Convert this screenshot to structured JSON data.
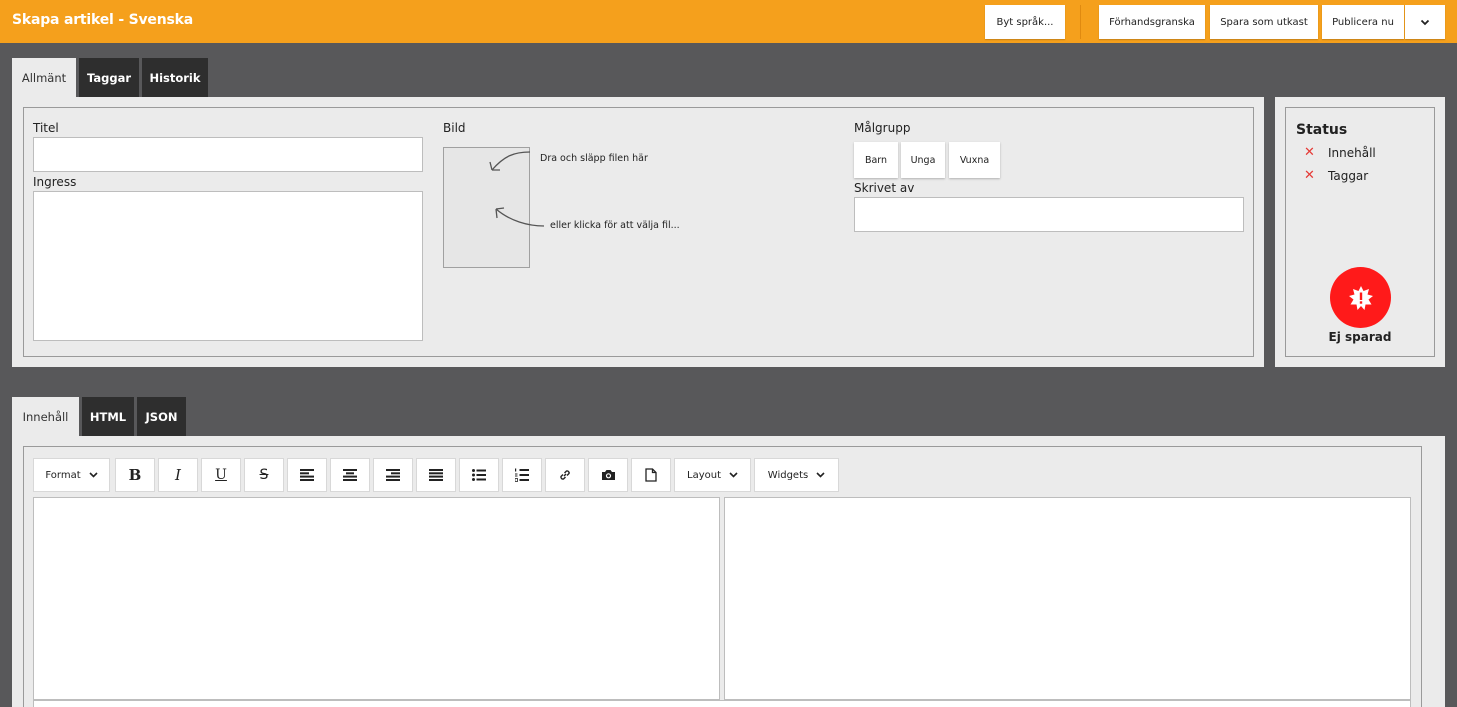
{
  "header": {
    "title": "Skapa artikel - Svenska",
    "buttons": {
      "switch_language": "Byt språk...",
      "preview": "Förhandsgranska",
      "save_draft": "Spara som utkast",
      "publish_now": "Publicera nu"
    }
  },
  "top_tabs": [
    "Allmänt",
    "Taggar",
    "Historik"
  ],
  "form": {
    "title_label": "Titel",
    "title_value": "",
    "ingress_label": "Ingress",
    "ingress_value": "",
    "image_label": "Bild",
    "image_hint_drag": "Dra och släpp filen här",
    "image_hint_click": "eller klicka för att välja fil...",
    "audience_label": "Målgrupp",
    "audience_options": [
      "Barn",
      "Unga",
      "Vuxna"
    ],
    "author_label": "Skrivet av",
    "author_value": ""
  },
  "status": {
    "title": "Status",
    "items": [
      "Innehåll",
      "Taggar"
    ],
    "state_label": "Ej sparad",
    "alert_color": "#ff1a1a",
    "error_color": "#e53935"
  },
  "content_tabs": [
    "Innehåll",
    "HTML",
    "JSON"
  ],
  "editor": {
    "format_label": "Format",
    "layout_label": "Layout",
    "widgets_label": "Widgets",
    "bold_glyph": "B",
    "italic_glyph": "I",
    "underline_glyph": "U",
    "strike_glyph": "S"
  },
  "colors": {
    "accent": "#f5a01c",
    "background": "#58585a",
    "panel": "#ebebeb",
    "tab_dark": "#2e2e2e"
  }
}
